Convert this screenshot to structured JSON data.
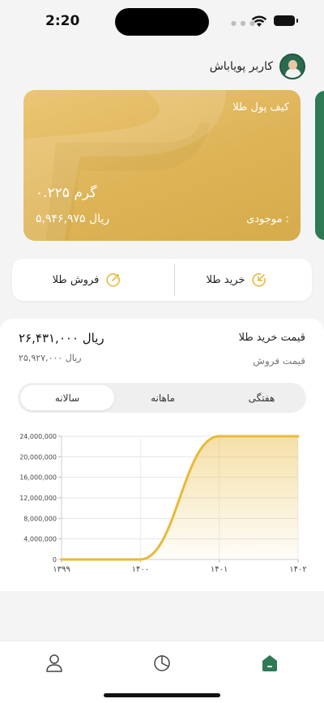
{
  "status_bar": {
    "time": "2:20"
  },
  "user": {
    "name": "کاربر پویاباش"
  },
  "wallet_card": {
    "title": "کیف پول طلا",
    "grams": "۰.۲۲۵ گرم",
    "balance_label": "موجودی :",
    "balance": "۵,۹۴۶,۹۷۵ ریال"
  },
  "actions": {
    "buy_label": "خرید طلا",
    "sell_label": "فروش طلا"
  },
  "price": {
    "buy_label": "قیمت خرید طلا",
    "buy_value": "۲۶,۴۳۱,۰۰۰ ریال",
    "sell_label": "قیمت فروش",
    "sell_value": "۲۵,۹۲۷,۰۰۰ ریال"
  },
  "tabs": [
    {
      "label": "هفتگی"
    },
    {
      "label": "ماهانه"
    },
    {
      "label": "سالانه",
      "active": true
    }
  ],
  "colors": {
    "gold": "#e8b93c",
    "card_gold": "#ddb356",
    "brand_green": "#2e7a55"
  },
  "icons": {
    "buy": "arrow-down-left-circle-icon",
    "sell": "arrow-up-right-circle-icon",
    "nav_profile": "person-icon",
    "nav_portfolio": "pie-chart-icon",
    "nav_home": "home-icon"
  },
  "chart_data": {
    "type": "area",
    "title": "",
    "xlabel": "",
    "ylabel": "",
    "ylim": [
      0,
      24000000
    ],
    "yticks": [
      0,
      4000000,
      8000000,
      12000000,
      16000000,
      20000000,
      24000000
    ],
    "ytick_labels": [
      "0",
      "4,000,000",
      "8,000,000",
      "12,000,000",
      "16,000,000",
      "20,000,000",
      "24,000,000"
    ],
    "x_labels": [
      "۱۳۹۹",
      "۱۴۰۰",
      "۱۴۰۱",
      "۱۴۰۲"
    ],
    "grid": true,
    "series": [
      {
        "x": [
          "۱۳۹۹",
          "۱۴۰۰",
          "۱۴۰۱",
          "۱۴۰۲"
        ],
        "values": [
          0,
          0,
          24000000,
          24000000
        ]
      }
    ]
  }
}
